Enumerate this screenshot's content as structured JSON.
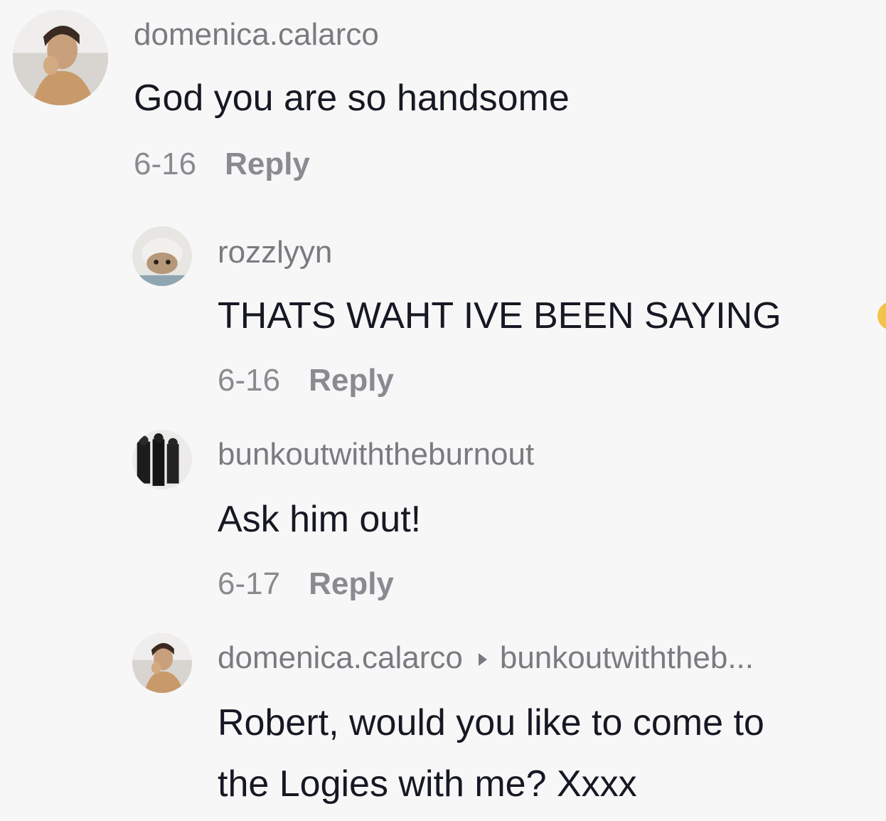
{
  "comments": [
    {
      "username": "domenica.calarco",
      "text": "God you are so handsome",
      "date": "6-16",
      "reply_label": "Reply"
    },
    {
      "username": "rozzlyyn",
      "text": "THATS WAHT IVE BEEN SAYING",
      "date": "6-16",
      "reply_label": "Reply"
    },
    {
      "username": "bunkoutwiththeburnout",
      "text": "Ask him out!",
      "date": "6-17",
      "reply_label": "Reply"
    },
    {
      "username": "domenica.calarco",
      "reply_to": "bunkoutwiththeb...",
      "text_line1": "Robert, would you like to come to",
      "text_line2": "the Logies with me? Xxxx"
    }
  ],
  "icons": {
    "reply_to_arrow": "caret-right-icon"
  },
  "colors": {
    "background": "#f7f7f7",
    "username": "#7a7b80",
    "text": "#161823",
    "meta": "#8a8b91"
  }
}
